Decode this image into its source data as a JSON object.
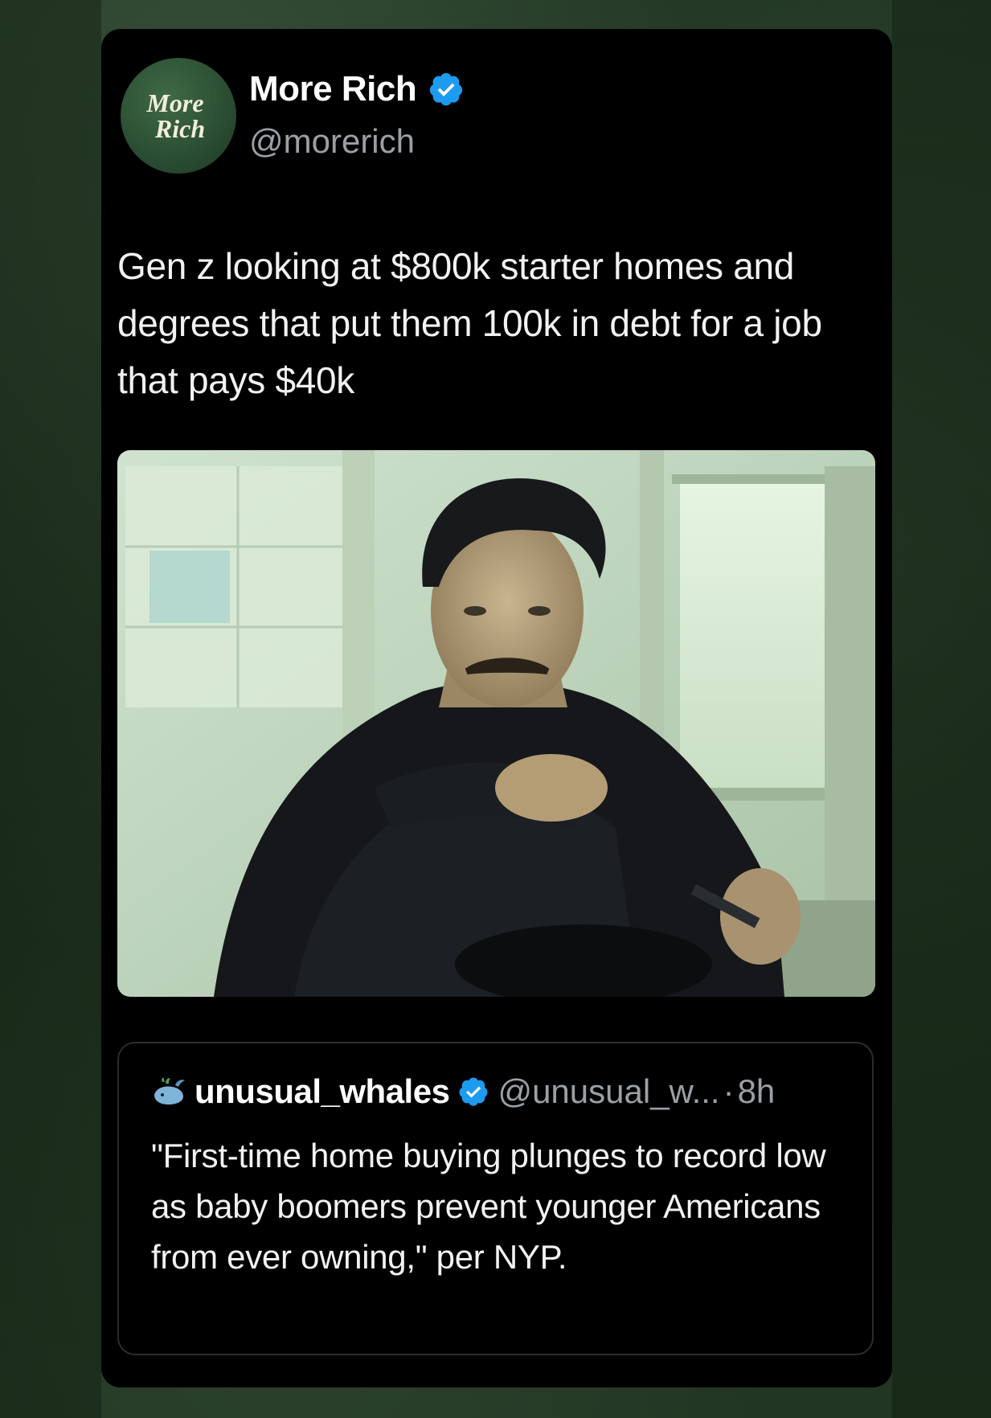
{
  "tweet": {
    "avatar_line1": "More",
    "avatar_line2": "Rich",
    "display_name": "More Rich",
    "handle": "@morerich",
    "verified_icon": "verified-badge",
    "text": "Gen z looking at $800k starter homes and degrees that put them 100k in debt for a job that pays $40k"
  },
  "quoted_tweet": {
    "icon": "whale-icon",
    "display_name": "unusual_whales",
    "handle": "@unusual_w...",
    "separator": "·",
    "time": "8h",
    "text": "\"First-time home buying plunges to record low as baby boomers prevent younger Americans from ever owning,\" per NYP."
  },
  "colors": {
    "background": "#1f3321",
    "card": "#000000",
    "verified_blue": "#1d9bf0",
    "muted_text": "#9aa0a6",
    "avatar_green": "#2d5234"
  }
}
